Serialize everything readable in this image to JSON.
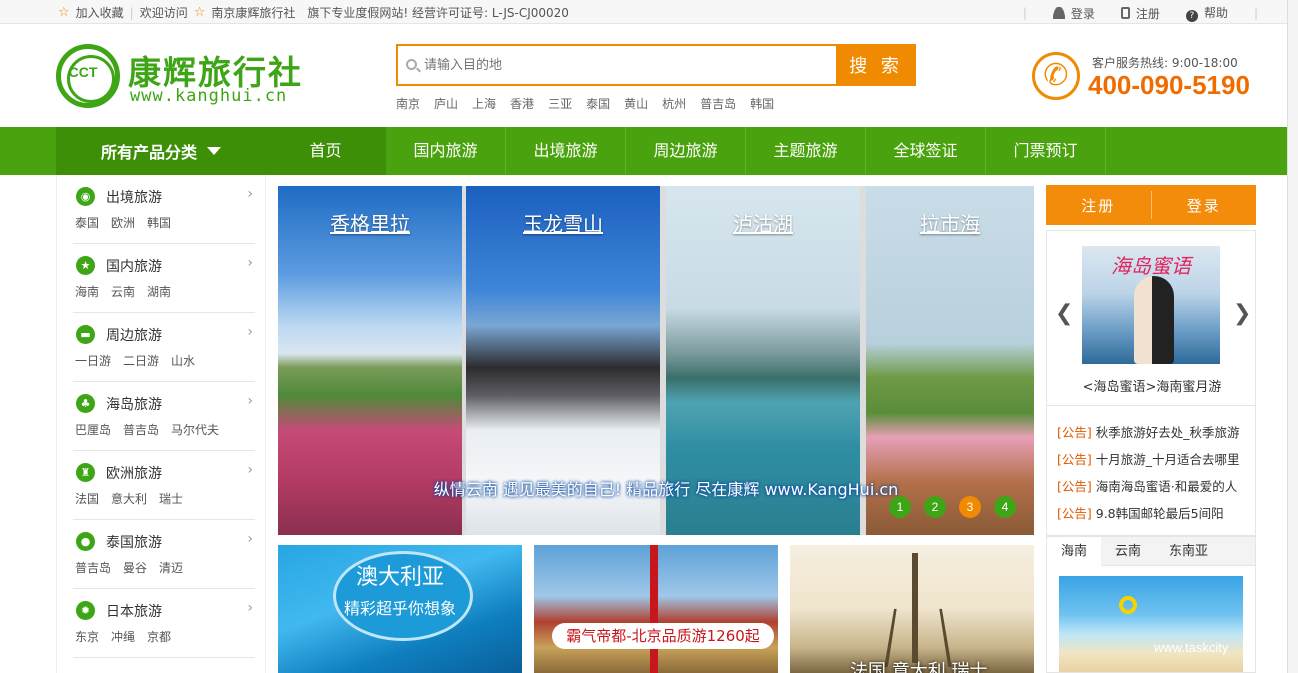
{
  "topbar": {
    "favorite": "加入收藏",
    "welcome": "欢迎访问",
    "company": "南京康辉旅行社",
    "tagline": "旗下专业度假网站! 经营许可证号: L-JS-CJ00020",
    "login": "登录",
    "register": "注册",
    "help": "帮助",
    "icons": [
      "star-icon",
      "user-icon",
      "phone-icon",
      "help-icon"
    ]
  },
  "logo": {
    "mark": "CCT",
    "name": "康辉旅行社",
    "url": "www.kanghui.cn",
    "color": "#3ea516"
  },
  "search": {
    "placeholder": "请输入目的地",
    "button": "搜 索",
    "hot": [
      "南京",
      "庐山",
      "上海",
      "香港",
      "三亚",
      "泰国",
      "黄山",
      "杭州",
      "普吉岛",
      "韩国"
    ]
  },
  "hotline": {
    "label": "客户服务热线: 9:00-18:00",
    "number": "400-090-5190"
  },
  "nav": {
    "all": "所有产品分类",
    "items": [
      "首页",
      "国内旅游",
      "出境旅游",
      "周边旅游",
      "主题旅游",
      "全球签证",
      "门票预订"
    ],
    "active_index": 0
  },
  "categories": [
    {
      "title": "出境旅游",
      "icon": "globe-icon",
      "glyph": "◉",
      "subs": [
        "泰国",
        "欧洲",
        "韩国"
      ]
    },
    {
      "title": "国内旅游",
      "icon": "star-badge-icon",
      "glyph": "★",
      "subs": [
        "海南",
        "云南",
        "湖南"
      ]
    },
    {
      "title": "周边旅游",
      "icon": "car-icon",
      "glyph": "▬",
      "subs": [
        "一日游",
        "二日游",
        "山水"
      ]
    },
    {
      "title": "海岛旅游",
      "icon": "palm-icon",
      "glyph": "♣",
      "subs": [
        "巴厘岛",
        "普吉岛",
        "马尔代夫"
      ]
    },
    {
      "title": "欧洲旅游",
      "icon": "castle-icon",
      "glyph": "♜",
      "subs": [
        "法国",
        "意大利",
        "瑞士"
      ]
    },
    {
      "title": "泰国旅游",
      "icon": "elephant-icon",
      "glyph": "●",
      "subs": [
        "普吉岛",
        "曼谷",
        "清迈"
      ]
    },
    {
      "title": "日本旅游",
      "icon": "sun-icon",
      "glyph": "✹",
      "subs": [
        "东京",
        "冲绳",
        "京都"
      ]
    }
  ],
  "banner": {
    "panels": [
      "香格里拉",
      "玉龙雪山",
      "泸沽湖",
      "拉市海"
    ],
    "caption": "纵情云南 遇见最美的自己! 精品旅行 尽在康辉 www.KangHui.cn",
    "dots": [
      "1",
      "2",
      "3",
      "4"
    ],
    "active_dot": 2
  },
  "tiles": [
    {
      "title": "澳大利亚",
      "subtitle": "精彩超乎你想象"
    },
    {
      "ribbon": "霸气帝都-北京品质游1260起"
    },
    {
      "text": "法国 意大利 瑞士"
    }
  ],
  "auth": {
    "register": "注册",
    "login": "登录"
  },
  "feature": {
    "image_text": "海岛蜜语",
    "caption": "<海岛蜜语>海南蜜月游",
    "prev": "❮",
    "next": "❯"
  },
  "notices": [
    {
      "tag": "[公告]",
      "text": "秋季旅游好去处_秋季旅游"
    },
    {
      "tag": "[公告]",
      "text": "十月旅游_十月适合去哪里"
    },
    {
      "tag": "[公告]",
      "text": "海南海岛蜜语·和最爱的人"
    },
    {
      "tag": "[公告]",
      "text": "9.8韩国邮轮最后5间阳"
    }
  ],
  "region_tabs": [
    "海南",
    "云南",
    "东南亚"
  ],
  "watermark": "www.taskcity",
  "colors": {
    "green": "#4aa30e",
    "dark_green": "#3c8f07",
    "orange": "#f08a00"
  }
}
